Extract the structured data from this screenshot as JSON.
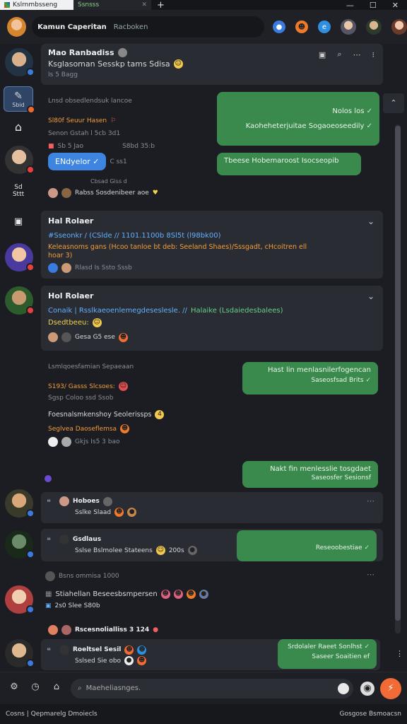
{
  "tabs": [
    {
      "label": "Kslrnmbsseng"
    },
    {
      "label": "Ssnsss"
    }
  ],
  "header": {
    "contact_name": "Kamun Caperitan",
    "contact_sub": "Racboken"
  },
  "sidebar": {
    "active_label": "Sbid",
    "item2_label": "Sd\nSttt"
  },
  "thread1": {
    "name": "Mao Ranbadiss",
    "preview": "Ksglasoman Sesskp tams Sdisa",
    "time": "Is 5 Bagg"
  },
  "block1": {
    "title": "Lnsd obsedlendsuk lancoe",
    "line1": "Sl80f Seuur Hasen",
    "line2": "Senon Gstah l 5cb 3d1",
    "line3": "Sb 5 Jao",
    "line3b": "S8bd 35:b",
    "pill": "ENdyelor",
    "pill_meta": "C  ss1",
    "meta2": "Cbsad Giss d",
    "reactions": "Rabss  Sosdenibeer aoe"
  },
  "bubbles_top": [
    {
      "text": "Nolos los",
      "sub": "Kaoheheterjuitae Sogaoeoseedily"
    },
    {
      "text": "Tbeese Hobemaroost Isocseopib"
    }
  ],
  "card2": {
    "title": "Hal Rolaer",
    "line1": "#Sseonkr / (CSlde // 1101.1100b 8Sl5t (l98bk00)",
    "line2": "Keleasnoms gans (Hcoo tanloe bt deb: Seeland Shaes)/Sssgadt, cHcoitren ell",
    "line3": "hoar 3)",
    "foot": "Rlasd Is Ssto Sssb"
  },
  "card3": {
    "title": "Hol Rolaer",
    "line1": "Conaik | Rsslkaeoenlemegdeseslesle. //",
    "line1b": "Halaike (Lsdaiedesbalees)",
    "line2": "Dsedtbeeu:",
    "foot": "Gesa     G5  ese"
  },
  "block2": {
    "title": "Lsmlqoesfamian Sepaeaan",
    "line1": "S193/ Gasss Slcsoes:",
    "line2": "Sgsp  Coloo   ssd Ssob",
    "line3": "Foesnalsmkenshoy Seolerissps",
    "line4": "Seglvea Daoseflemsa",
    "foot": "Gkjs   Is5   3 bao"
  },
  "bubbles_mid": [
    {
      "text": "Hast lin menlasnilerfogencan",
      "sub": "Saseosfsad Brits"
    },
    {
      "text": "Nakt fin menlesslie tosgdaet",
      "sub": "Saseosfer Sesionsf"
    }
  ],
  "card4": {
    "title": "Hoboes",
    "line": "Sslke  Slaad"
  },
  "card5": {
    "title": "Gsdlaus",
    "line": "Sslse Bslmolee Stateens",
    "time": "200s",
    "bubble": "Reseoobestiae"
  },
  "block3": {
    "title": "Bsns ommisa 1000",
    "line1": "Stiahellan Beseesbsmpersen",
    "line2": "2s0  Slee  S80b",
    "foot": "Rscesnolialliss  3 124"
  },
  "card6": {
    "title": "Roeltsel Sesil",
    "line": "Sslsed Sie  obo",
    "bubble": "Srdolaler Raeet Sonlhst",
    "bubble_sub": "Saseer Soaitien ef"
  },
  "composer": {
    "placeholder": "Maeheliasnges."
  },
  "status": {
    "left": "Cosns | Qepmarelg Dmoiecls",
    "right": "Gosgose  Bsmoacsn"
  },
  "colors": {
    "bubble": "#3a8a4d",
    "accent": "#63b0ff",
    "send": "#f26a35"
  }
}
